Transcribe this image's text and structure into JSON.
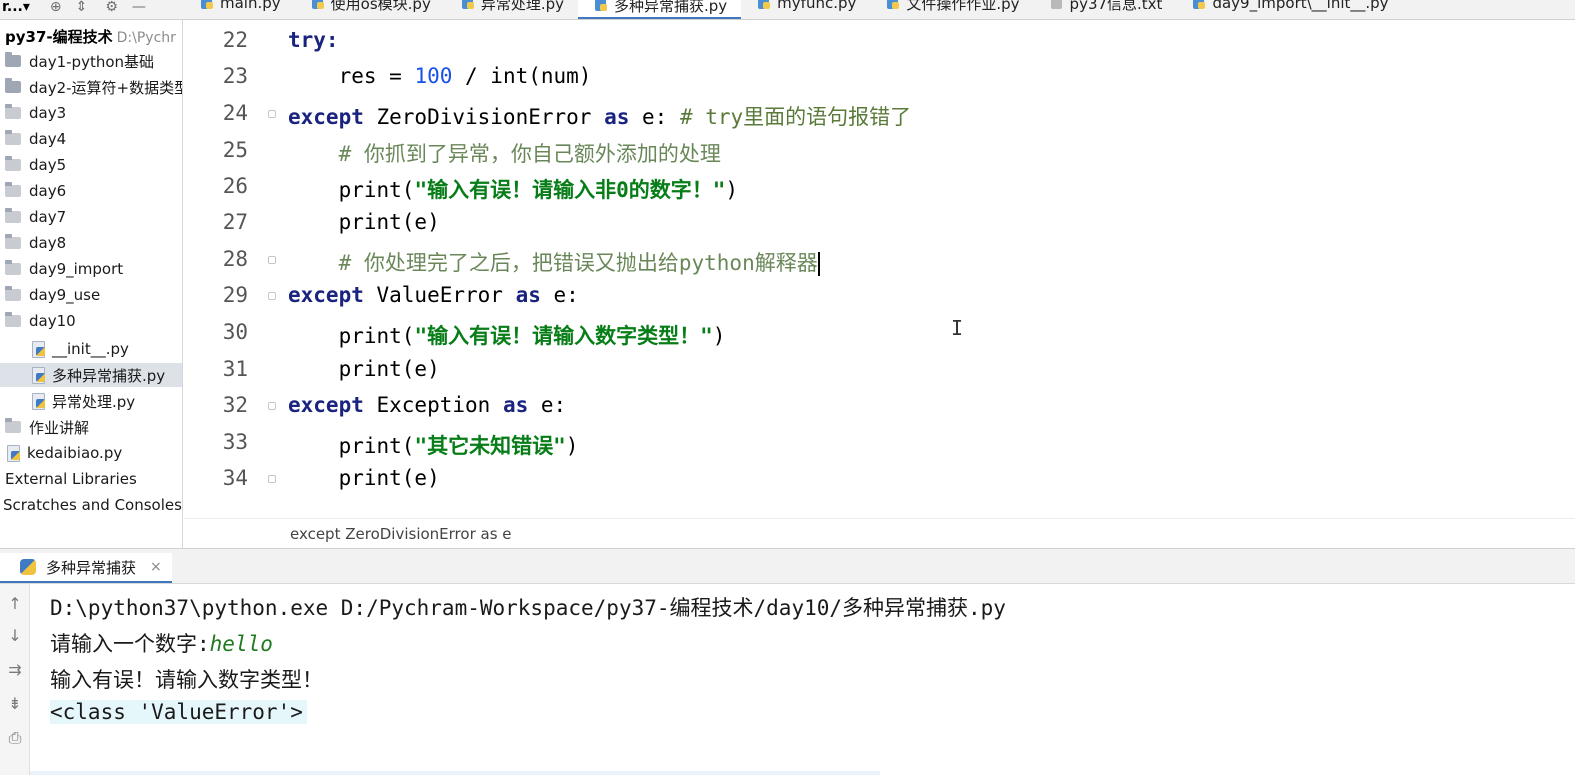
{
  "project_header": {
    "selector_label": "r...▾",
    "tool_icons": [
      "target-icon",
      "collapse-icon",
      "gear-icon",
      "minimize-icon"
    ]
  },
  "tabs": [
    {
      "label": "main.py",
      "kind": "py",
      "active": false
    },
    {
      "label": "使用os模块.py",
      "kind": "py",
      "active": false
    },
    {
      "label": "异常处理.py",
      "kind": "py",
      "active": false
    },
    {
      "label": "多种异常捕获.py",
      "kind": "py",
      "active": true
    },
    {
      "label": "myfunc.py",
      "kind": "py",
      "active": false
    },
    {
      "label": "文件操作作业.py",
      "kind": "py",
      "active": false
    },
    {
      "label": "py37信息.txt",
      "kind": "txt",
      "active": false
    },
    {
      "label": "day9_import\\__init__.py",
      "kind": "py",
      "active": false
    }
  ],
  "project_tree": {
    "root_name": "py37-编程技术",
    "root_path": "D:\\Pychr",
    "items": [
      {
        "label": "day1-python基础",
        "type": "folder"
      },
      {
        "label": "day2-运算符+数据类型",
        "type": "folder"
      },
      {
        "label": "day3",
        "type": "folder"
      },
      {
        "label": "day4",
        "type": "folder"
      },
      {
        "label": "day5",
        "type": "folder"
      },
      {
        "label": "day6",
        "type": "folder"
      },
      {
        "label": "day7",
        "type": "folder"
      },
      {
        "label": "day8",
        "type": "folder"
      },
      {
        "label": "day9_import",
        "type": "folder"
      },
      {
        "label": "day9_use",
        "type": "folder"
      },
      {
        "label": "day10",
        "type": "folder"
      },
      {
        "label": "__init__.py",
        "type": "py"
      },
      {
        "label": "多种异常捕获.py",
        "type": "py",
        "selected": true
      },
      {
        "label": "异常处理.py",
        "type": "py"
      },
      {
        "label": "作业讲解",
        "type": "folder"
      },
      {
        "label": "kedaibiao.py",
        "type": "py"
      },
      {
        "label": "External Libraries",
        "type": "lib"
      },
      {
        "label": "Scratches and Consoles",
        "type": "lib"
      }
    ]
  },
  "editor": {
    "line_numbers": [
      "22",
      "23",
      "24",
      "25",
      "26",
      "27",
      "28",
      "29",
      "30",
      "31",
      "32",
      "33",
      "34"
    ],
    "code": {
      "l22_kw": "try:",
      "l23_a": "    res = ",
      "l23_num": "100",
      "l23_b": " / int(num)",
      "l24_kw1": "except",
      "l24_cls": " ZeroDivisionError ",
      "l24_kw2": "as",
      "l24_e": " e: ",
      "l24_cmt": "# try里面的语句报错了",
      "l25_cmt": "    # 你抓到了异常，你自己额外添加的处理",
      "l26_a": "    print(",
      "l26_str": "\"输入有误！请输入非0的数字！\"",
      "l26_b": ")",
      "l27": "    print(e)",
      "l28_cmt": "    # 你处理完了之后，把错误又抛出给python解释器",
      "l29_kw1": "except",
      "l29_cls": " ValueError ",
      "l29_kw2": "as",
      "l29_e": " e:",
      "l30_a": "    print(",
      "l30_str": "\"输入有误！请输入数字类型！\"",
      "l30_b": ")",
      "l31": "    print(e)",
      "l32_kw1": "except",
      "l32_cls": " Exception ",
      "l32_kw2": "as",
      "l32_e": " e:",
      "l33_a": "    print(",
      "l33_str": "\"其它未知错误\"",
      "l33_b": ")",
      "l34": "    print(e)"
    }
  },
  "breadcrumb": "except ZeroDivisionError as e",
  "run_panel": {
    "tab_label": "多种异常捕获",
    "close_glyph": "×",
    "side_icons": [
      "↑",
      "↓",
      "⇉",
      "⇟",
      "⎙"
    ],
    "lines": {
      "cmd": "D:\\python37\\python.exe D:/Pychram-Workspace/py37-编程技术/day10/多种异常捕获.py",
      "prompt": "请输入一个数字:",
      "input": "hello",
      "msg": "输入有误！请输入数字类型！",
      "err": "<class 'ValueError'>"
    }
  },
  "colors": {
    "keyword": "#1a237e",
    "string": "#067d17",
    "number": "#1750eb",
    "comment": "#6a8759",
    "active_tab_underline": "#4078c0",
    "console_input": "#1e7a1e"
  }
}
